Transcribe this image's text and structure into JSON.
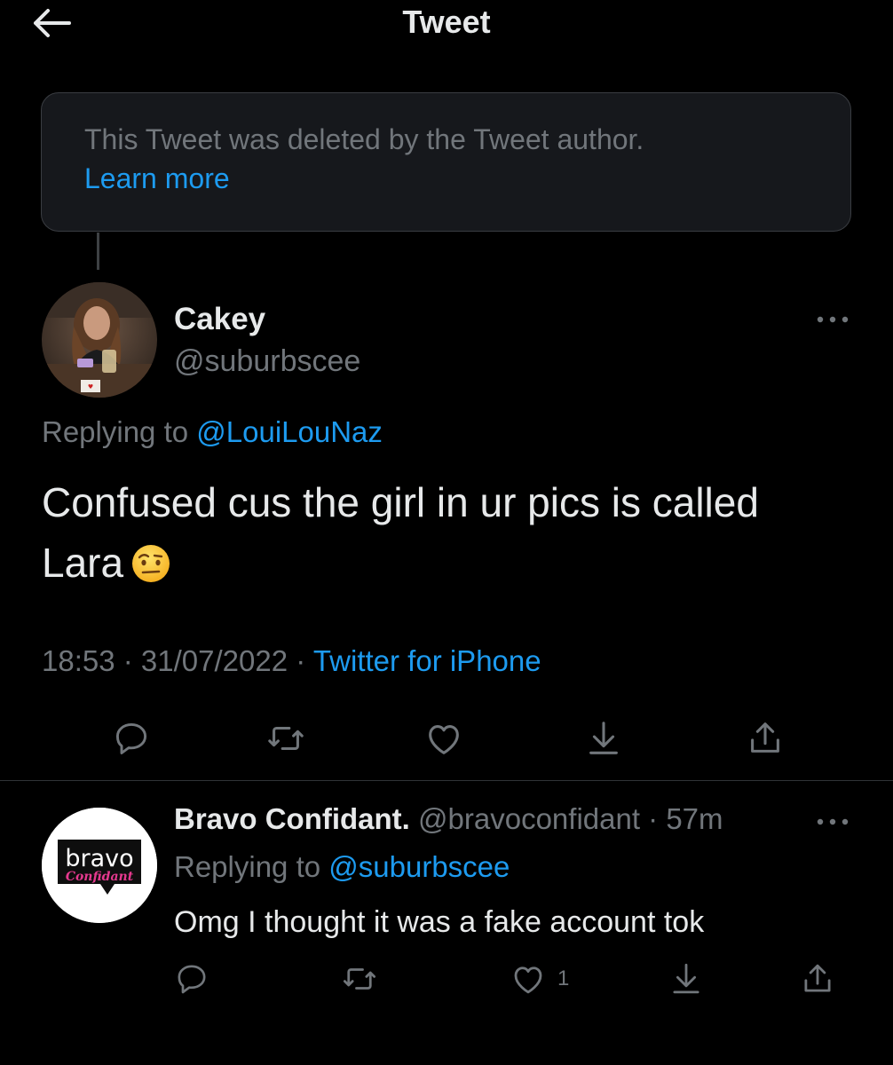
{
  "header": {
    "title": "Tweet",
    "back_icon": "arrow-left-icon"
  },
  "deleted_notice": {
    "text": "This Tweet was deleted by the Tweet author.",
    "link": "Learn more"
  },
  "main_tweet": {
    "display_name": "Cakey",
    "handle": "@suburbscee",
    "replying_prefix": "Replying to ",
    "replying_to": "@LouiLouNaz",
    "text_line1": "Confused cus the girl in ur pics is called",
    "text_line2": "Lara",
    "emoji": "face-with-raised-eyebrow",
    "time": "18:53",
    "date": "31/07/2022",
    "separator": " · ",
    "source": "Twitter for iPhone",
    "actions": [
      "reply-icon",
      "retweet-icon",
      "like-icon",
      "bookmark-icon",
      "share-icon"
    ]
  },
  "reply_tweet": {
    "display_name": "Bravo Confidant.",
    "handle": "@bravoconfidant",
    "separator": " · ",
    "time_ago": "57m",
    "avatar_text_top": "bravo",
    "avatar_text_bottom": "Confidant",
    "replying_prefix": "Replying to ",
    "replying_to": "@suburbscee",
    "text": "Omg I thought it was a fake account tok",
    "like_count": "1"
  },
  "colors": {
    "background": "#000000",
    "text_primary": "#e7e9ea",
    "text_secondary": "#71767b",
    "accent": "#1d9bf0",
    "card_border": "#3a3d42"
  }
}
